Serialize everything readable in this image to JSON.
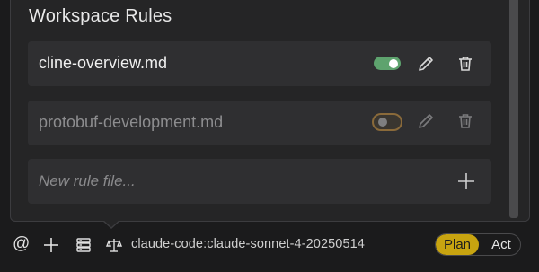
{
  "panel": {
    "title": "Workspace Rules",
    "rules": [
      {
        "name": "cline-overview.md",
        "enabled": true
      },
      {
        "name": "protobuf-development.md",
        "enabled": false
      }
    ],
    "new_rule_placeholder": "New rule file..."
  },
  "toolbar": {
    "at_label": "@",
    "model": "claude-code:claude-sonnet-4-20250514",
    "mode_plan": "Plan",
    "mode_act": "Act",
    "active_mode": "Plan"
  },
  "colors": {
    "toggle_on": "#5ea36e",
    "plan_active": "#c8a410"
  }
}
